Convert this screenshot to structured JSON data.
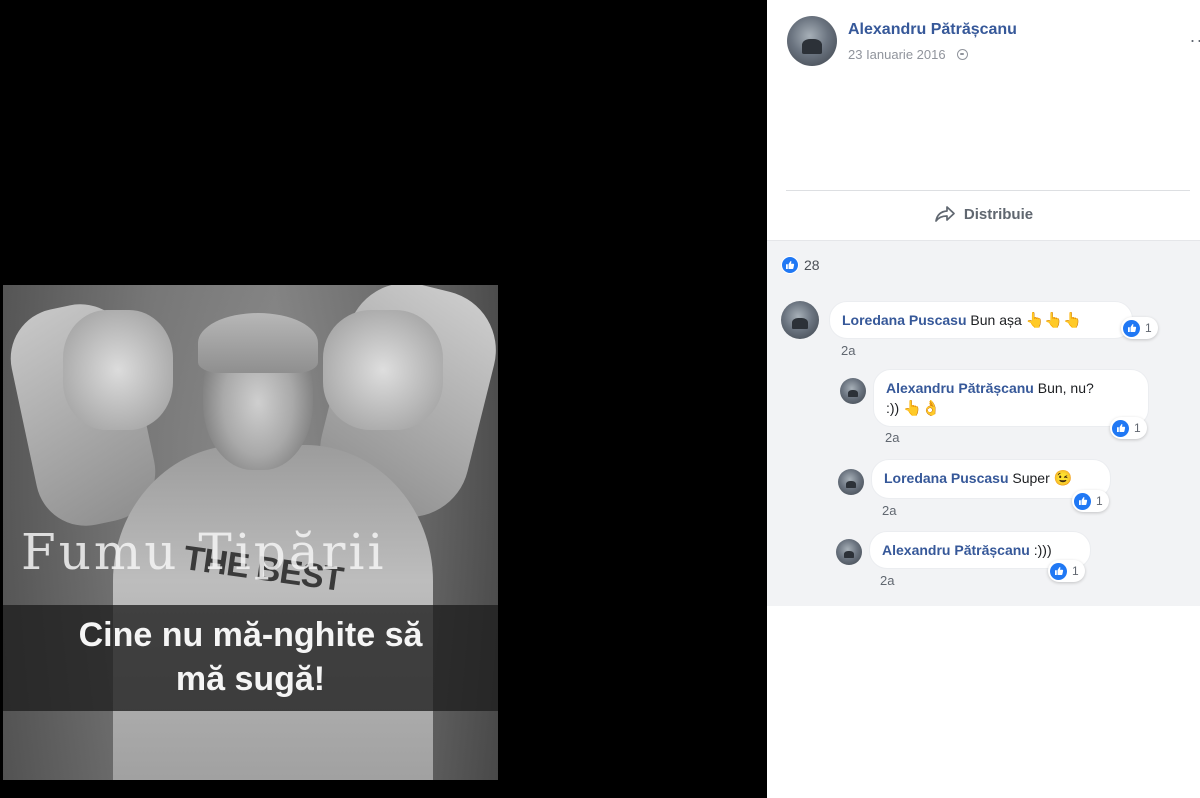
{
  "post": {
    "author": "Alexandru Pătrășcanu",
    "date": "23 Ianuarie 2016",
    "more": "···",
    "share_label": "Distribuie",
    "reaction_count": "28"
  },
  "photo": {
    "watermark": "Fumu Tipării",
    "shirt_text": "THE BEST",
    "caption_line1": "Cine nu mă-nghite să",
    "caption_line2": "mă sugă!"
  },
  "comments": [
    {
      "name": "Loredana Puscasu",
      "text": "Bun așa",
      "emoji": "👆👆👆",
      "time": "2a",
      "likes": "1"
    },
    {
      "name": "Alexandru Pătrășcanu",
      "text": "Bun, nu?",
      "text2": ":))",
      "emoji": "👆👌",
      "time": "2a",
      "likes": "1"
    },
    {
      "name": "Loredana Puscasu",
      "text": "Super",
      "emoji": "😉",
      "time": "2a",
      "likes": "1"
    },
    {
      "name": "Alexandru Pătrășcanu",
      "text": ":)))",
      "time": "2a",
      "likes": "1"
    }
  ],
  "colors": {
    "link": "#365899",
    "like_blue": "#2078f4",
    "panel_bg": "#f2f3f5"
  }
}
